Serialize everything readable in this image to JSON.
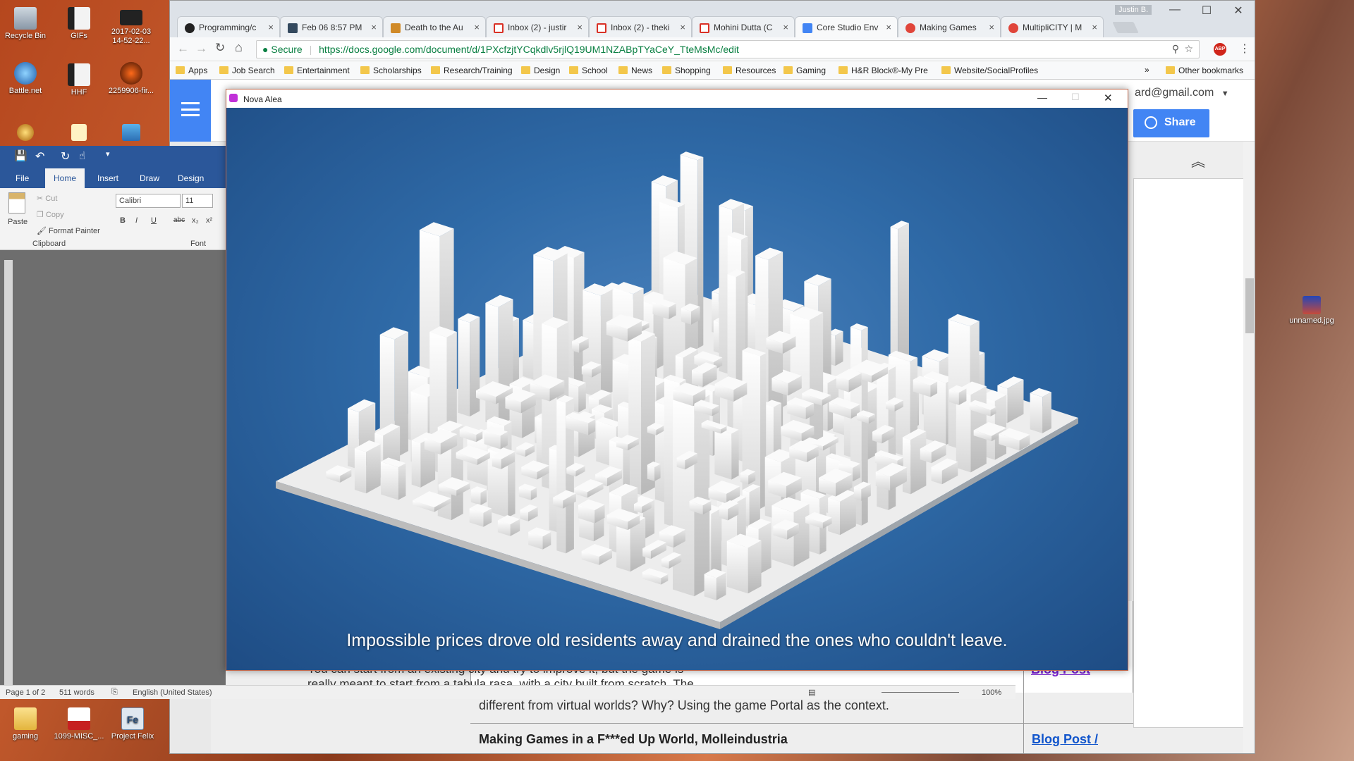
{
  "desktop": {
    "icons": [
      {
        "label": "Recycle Bin"
      },
      {
        "label": "GIFs"
      },
      {
        "label": "2017-02-03 14-52-22..."
      },
      {
        "label": "Battle.net"
      },
      {
        "label": "HHF"
      },
      {
        "label": "2259906-fir..."
      },
      {
        "label": "unnamed.jpg"
      },
      {
        "label": "gaming"
      },
      {
        "label": "1099-MISC_..."
      },
      {
        "label": "Project Felix"
      }
    ]
  },
  "chrome": {
    "profile": "Justin B.",
    "tabs": [
      {
        "label": "Programming/c"
      },
      {
        "label": "Feb 06 8:57 PM"
      },
      {
        "label": "Death to the Au"
      },
      {
        "label": "Inbox (2) - justir"
      },
      {
        "label": "Inbox (2) - theki"
      },
      {
        "label": "Mohini Dutta (C"
      },
      {
        "label": "Core Studio Env"
      },
      {
        "label": "Making Games"
      },
      {
        "label": "MultipliCITY | M"
      }
    ],
    "secure_label": "Secure",
    "url": "https://docs.google.com/document/d/1PXcfzjtYCqkdlv5rjlQ19UM1NZABpTYaCeY_TteMsMc/edit",
    "bookmarks": [
      "Apps",
      "Job Search",
      "Entertainment",
      "Scholarships",
      "Research/Training",
      "Design",
      "School",
      "News",
      "Shopping",
      "Resources",
      "Gaming",
      "H&R Block®-My Pre",
      "Website/SocialProfiles"
    ],
    "other_bookmarks": "Other bookmarks"
  },
  "docs": {
    "account": "ard@gmail.com",
    "share_label": "Share",
    "body_line_1": "different from virtual worlds? Why? Using the game Portal as the context.",
    "row_title": "Making Games in a F***ed Up World, Molleindustria",
    "row_link": "Blog Post /",
    "partial_link": "Blog Post"
  },
  "word": {
    "tabs": [
      "File",
      "Home",
      "Insert",
      "Draw",
      "Design"
    ],
    "clipboard": {
      "paste": "Paste",
      "cut": "Cut",
      "copy": "Copy",
      "format_painter": "Format Painter",
      "group": "Clipboard"
    },
    "font": {
      "name": "Calibri",
      "size": "11",
      "group": "Font"
    },
    "doc_text_1": "You can start from an existing city and try to improve it, but the game is",
    "doc_text_2": "really meant to start from a tabula rasa, with a city built from scratch. The",
    "status": {
      "page": "Page 1 of 2",
      "words": "511 words",
      "language": "English (United States)",
      "zoom": "100%"
    }
  },
  "nova": {
    "title": "Nova Alea",
    "subtitle": "Impossible prices drove old residents away and drained the ones who couldn't leave."
  }
}
